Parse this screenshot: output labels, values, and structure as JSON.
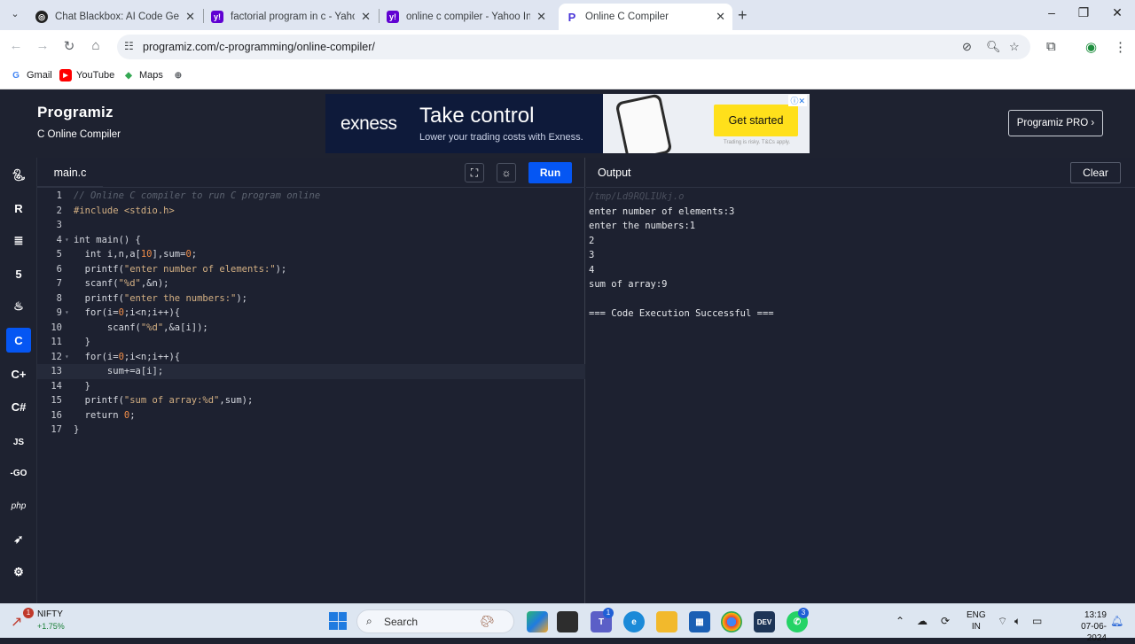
{
  "browser": {
    "tabs": [
      {
        "title": "Chat Blackbox: AI Code Generat",
        "icon": "blackbox-icon"
      },
      {
        "title": "factorial program in c - Yahoo I",
        "icon": "yahoo-icon"
      },
      {
        "title": "online c compiler - Yahoo India",
        "icon": "yahoo-icon"
      },
      {
        "title": "Online C Compiler",
        "icon": "programiz-icon",
        "active": true
      }
    ],
    "url": "programiz.com/c-programming/online-compiler/",
    "bookmarks": [
      {
        "label": "Gmail",
        "icon": "google-icon"
      },
      {
        "label": "YouTube",
        "icon": "youtube-icon"
      },
      {
        "label": "Maps",
        "icon": "maps-icon"
      }
    ]
  },
  "site": {
    "logo": "Programiz",
    "subtitle": "C Online Compiler",
    "pro_button": "Programiz PRO ›"
  },
  "ad": {
    "brand": "exness",
    "headline": "Take control",
    "subline": "Lower your trading costs with Exness.",
    "cta": "Get started",
    "fineprint": "Trading is risky. T&Cs apply."
  },
  "editor": {
    "file_tab": "main.c",
    "run_label": "Run",
    "lines": [
      "// Online C compiler to run C program online",
      "#include <stdio.h>",
      "",
      "int main() {",
      "  int i,n,a[10],sum=0;",
      "  printf(\"enter number of elements:\");",
      "  scanf(\"%d\",&n);",
      "  printf(\"enter the numbers:\");",
      "  for(i=0;i<n;i++){",
      "      scanf(\"%d\",&a[i]);",
      "  }",
      "  for(i=0;i<n;i++){",
      "      sum+=a[i];",
      "  }",
      "  printf(\"sum of array:%d\",sum);",
      "  return 0;",
      "}"
    ],
    "highlighted_line": 13
  },
  "output": {
    "title": "Output",
    "clear_label": "Clear",
    "path": "/tmp/Ld9RQLIUkj.o",
    "lines": [
      "enter number of elements:3",
      "enter the numbers:1",
      "2",
      "3",
      "4",
      "sum of array:9",
      "",
      "=== Code Execution Successful ==="
    ]
  },
  "taskbar": {
    "ticker_name": "NIFTY",
    "ticker_change": "+1.75%",
    "ticker_badge": "1",
    "search_placeholder": "Search",
    "teams_badge": "1",
    "whatsapp_badge": "3",
    "lang_top": "ENG",
    "lang_bottom": "IN",
    "time": "13:19",
    "date": "07-06-2024"
  }
}
